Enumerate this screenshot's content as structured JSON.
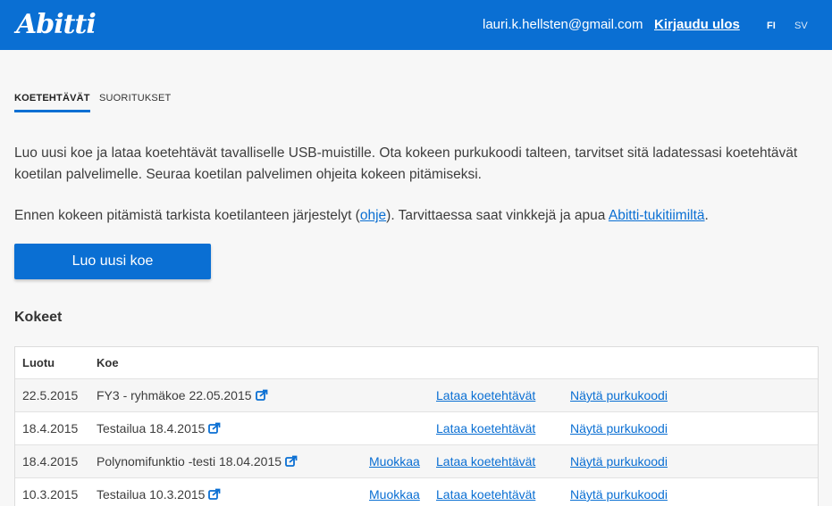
{
  "header": {
    "logo": "Abitti",
    "user_email": "lauri.k.hellsten@gmail.com",
    "logout": "Kirjaudu ulos",
    "lang_fi": "FI",
    "lang_sv": "SV"
  },
  "tabs": [
    {
      "label": "KOETEHTÄVÄT",
      "active": true
    },
    {
      "label": "SUORITUKSET",
      "active": false
    }
  ],
  "intro": {
    "paragraph1": "Luo uusi koe ja lataa koetehtävät tavalliselle USB-muistille. Ota kokeen purkukoodi talteen, tarvitset sitä ladatessasi koetehtävät koetilan palvelimelle. Seuraa koetilan palvelimen ohjeita kokeen pitämiseksi.",
    "p2_before": "Ennen kokeen pitämistä tarkista koetilanteen järjestelyt (",
    "p2_link1": "ohje",
    "p2_middle": "). Tarvittaessa saat vinkkejä ja apua ",
    "p2_link2": "Abitti-tukitiimiltä",
    "p2_after": "."
  },
  "new_exam_button": "Luo uusi koe",
  "exams": {
    "title": "Kokeet",
    "col_created": "Luotu",
    "col_exam": "Koe",
    "rows": [
      {
        "date": "22.5.2015",
        "name": "FY3 - ryhmäkoe 22.05.2015",
        "edit": "",
        "load": "Lataa koetehtävät",
        "code": "Näytä purkukoodi"
      },
      {
        "date": "18.4.2015",
        "name": "Testailua 18.4.2015",
        "edit": "",
        "load": "Lataa koetehtävät",
        "code": "Näytä purkukoodi"
      },
      {
        "date": "18.4.2015",
        "name": "Polynomifunktio -testi 18.04.2015",
        "edit": "Muokkaa",
        "load": "Lataa koetehtävät",
        "code": "Näytä purkukoodi"
      },
      {
        "date": "10.3.2015",
        "name": "Testailua 10.3.2015",
        "edit": "Muokkaa",
        "load": "Lataa koetehtävät",
        "code": "Näytä purkukoodi"
      }
    ]
  },
  "icons": {
    "external": "external-link-icon"
  },
  "colors": {
    "brand_blue": "#0a6fd3",
    "background": "#f7f7f7"
  }
}
